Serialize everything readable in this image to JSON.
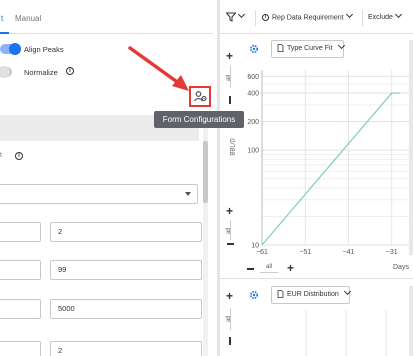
{
  "left": {
    "tabs": [
      "t",
      "Manual"
    ],
    "align_peaks": "Align Peaks",
    "normalize": "Normalize",
    "form_config_tooltip": "Form Configurations",
    "tiny_label": "t",
    "fields": {
      "row1_right": "2",
      "row2_right": "99",
      "row3_right": "5000",
      "row4_right": "2"
    }
  },
  "right": {
    "toolbar": {
      "filter_icon": "filter-icon",
      "rep_data_requirement": "Rep Data Requirement",
      "exclude": "Exclude"
    },
    "top_chart": {
      "dropdown": "Type Curve Fit",
      "y_axis_label": "BBL/D",
      "zoom_label_left": "all",
      "zoom_label_bottom": "all",
      "x_axis_label": "Days"
    },
    "bottom_chart": {
      "dropdown": "EUR Distribution",
      "zoom_label_left": "all"
    }
  },
  "colors": {
    "accent": "#1a73e8",
    "annotation_red": "#e53935",
    "curve": "#7ecfb3"
  },
  "chart_data": {
    "type": "line",
    "ylabel": "BBL/D",
    "xlabel": "Days",
    "y_scale": "log",
    "y_ticks": [
      600,
      400,
      200,
      100,
      10
    ],
    "x_ticks": [
      -61,
      -51,
      -41,
      -31
    ],
    "series": [
      {
        "x": [
          -61,
          -31,
          -30,
          -29
        ],
        "y": [
          10,
          400,
          400,
          400
        ]
      }
    ],
    "grid": true
  }
}
